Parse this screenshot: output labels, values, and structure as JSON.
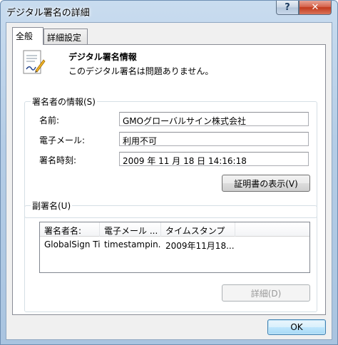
{
  "window": {
    "title": "デジタル署名の詳細"
  },
  "titlebar": {
    "help_label": "?",
    "close_label": "✕"
  },
  "tabs": [
    {
      "label": "全般",
      "active": true
    },
    {
      "label": "詳細設定",
      "active": false
    }
  ],
  "info": {
    "title": "デジタル署名情報",
    "description": "このデジタル署名は問題ありません。"
  },
  "signer": {
    "legend": "署名者の情報(S)",
    "fields": [
      {
        "label": "名前:",
        "value": "GMOグローバルサイン株式会社"
      },
      {
        "label": "電子メール:",
        "value": "利用不可"
      },
      {
        "label": "署名時刻:",
        "value": "2009 年 11 月 18 日 14:16:18"
      }
    ],
    "view_cert_button": "証明書の表示(V)"
  },
  "countersign": {
    "legend": "副署名(U)",
    "columns": [
      "署名者名:",
      "電子メール ...",
      "タイムスタンプ"
    ],
    "rows": [
      [
        "GlobalSign Ti...",
        "timestampin...",
        "2009年11月18..."
      ]
    ],
    "details_button": "詳細(D)"
  },
  "footer": {
    "ok_label": "OK"
  }
}
